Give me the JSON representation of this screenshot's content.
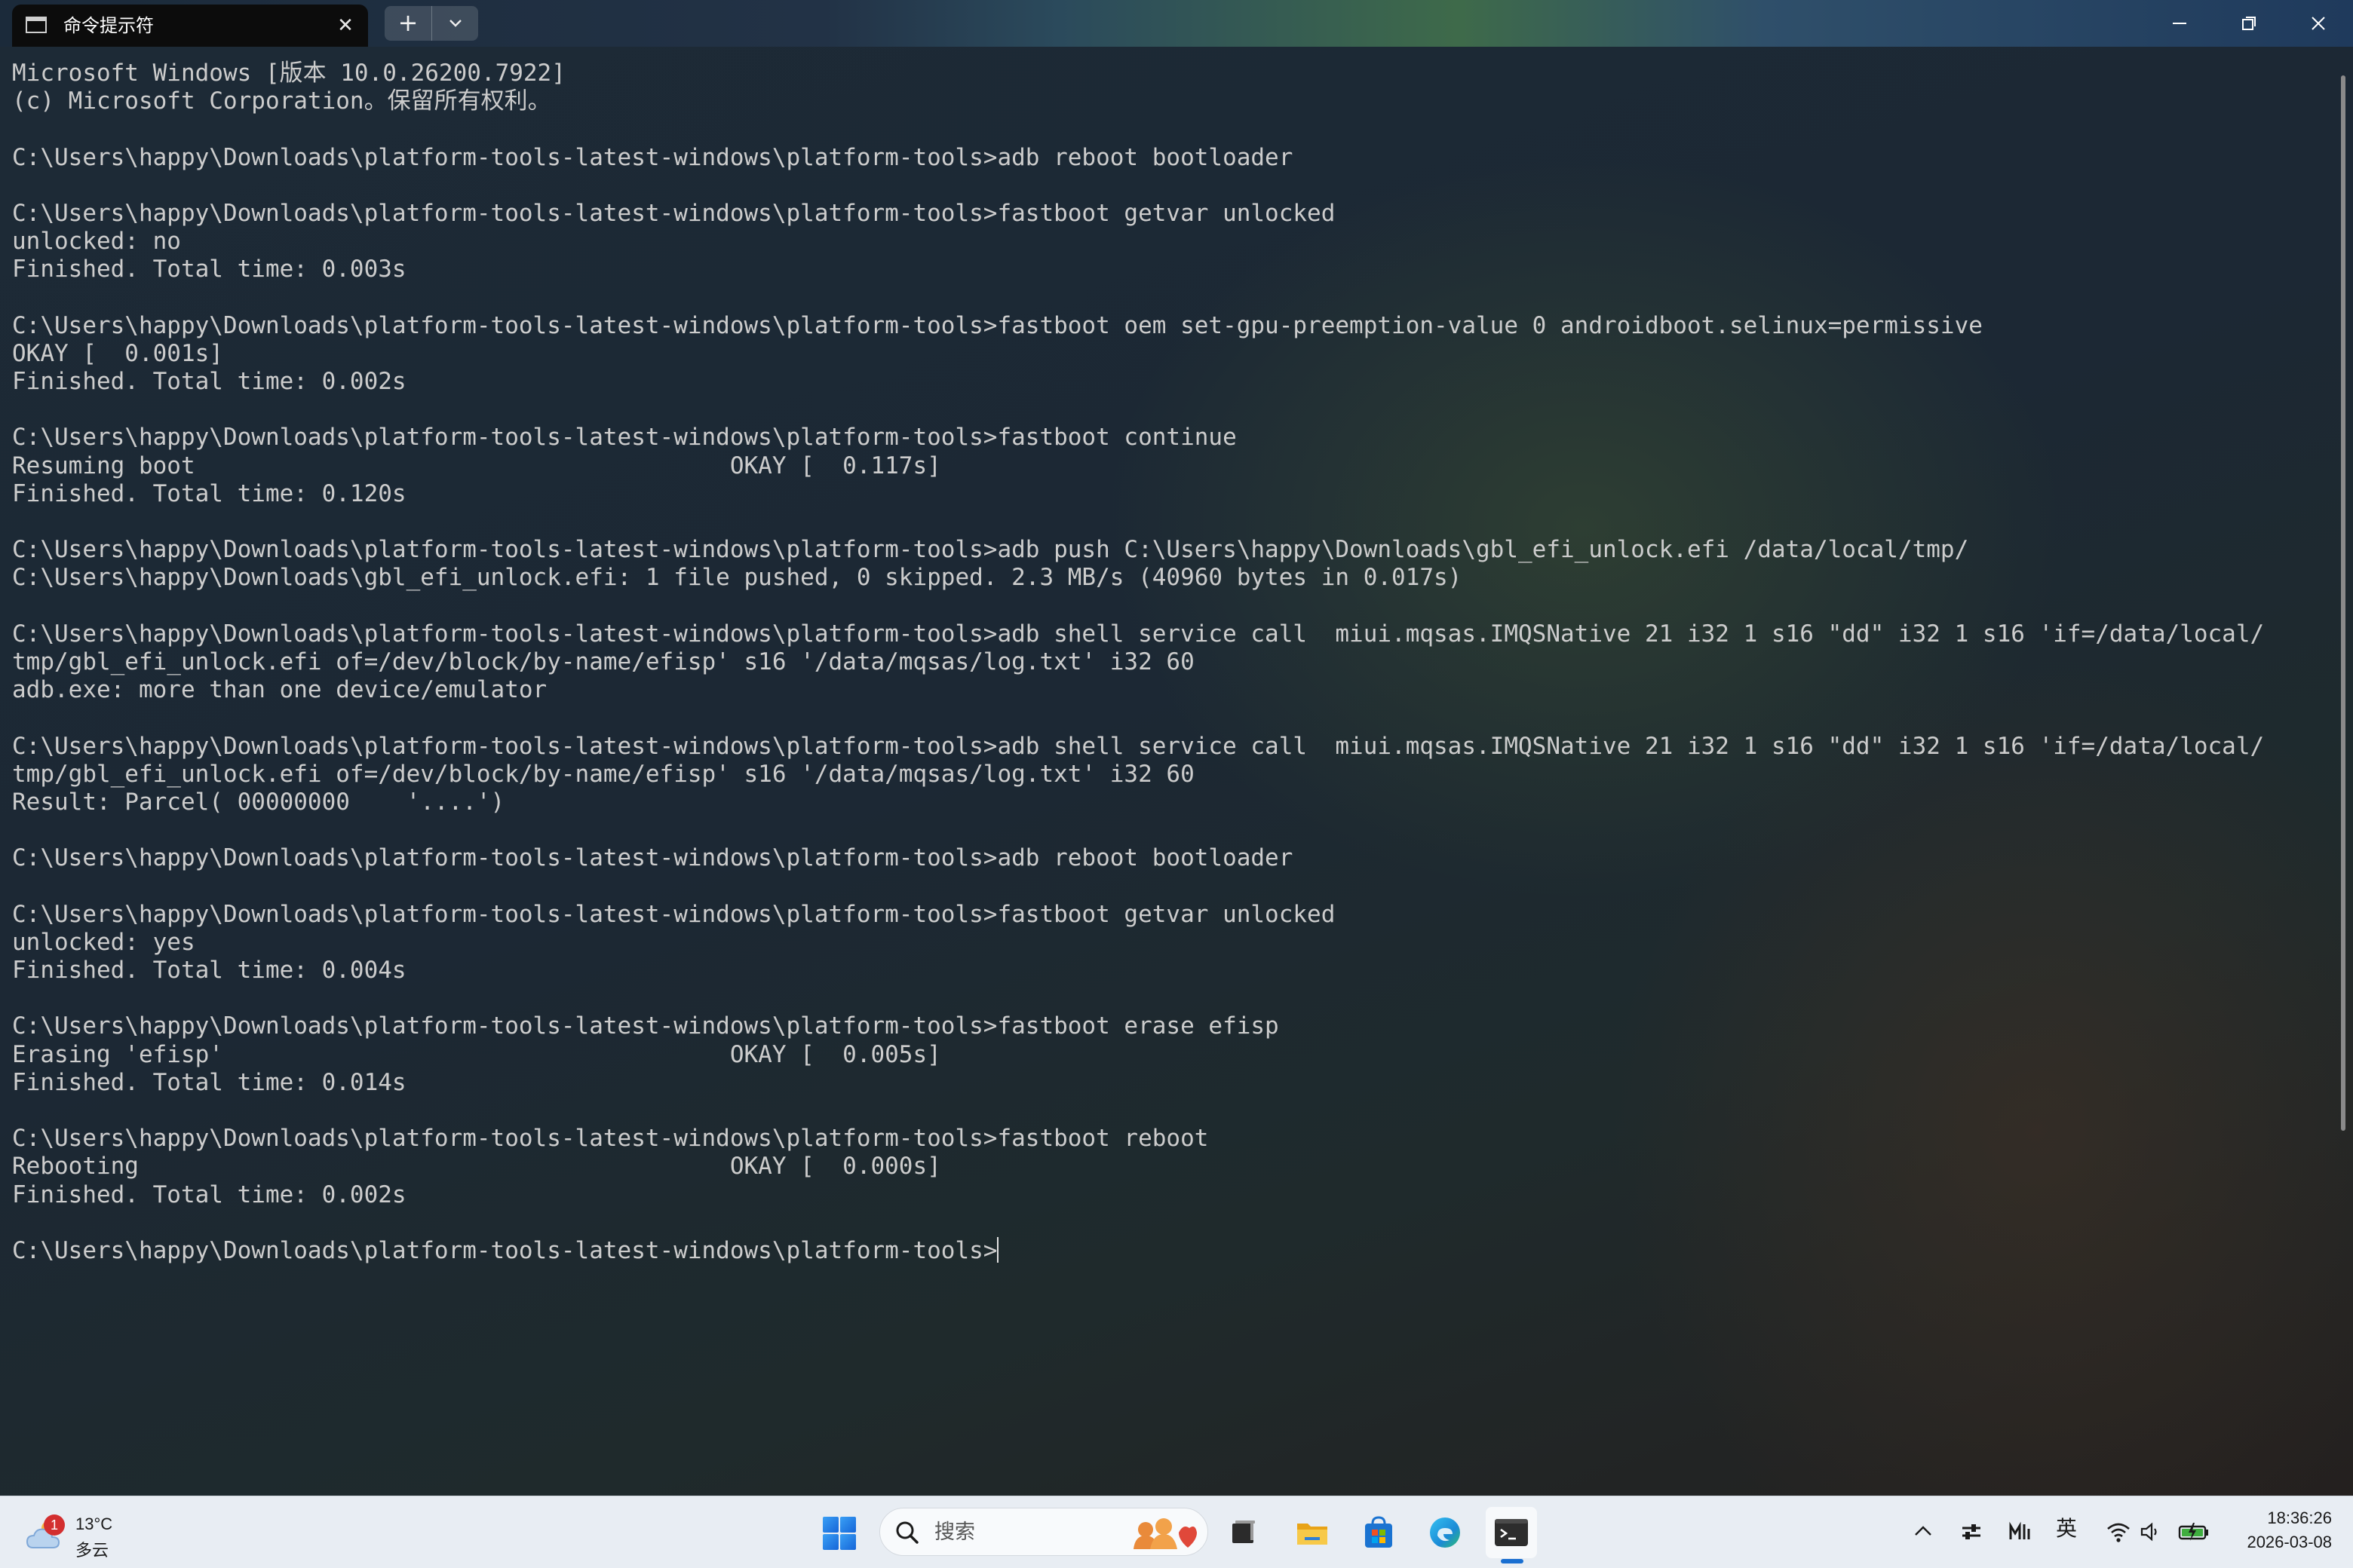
{
  "window": {
    "tab_title": "命令提示符",
    "tab_close_glyph": "✕",
    "new_tab_glyph": "+"
  },
  "terminal": {
    "lines": [
      "Microsoft Windows [版本 10.0.26200.7922]",
      "(c) Microsoft Corporation。保留所有权利。",
      "",
      "C:\\Users\\happy\\Downloads\\platform-tools-latest-windows\\platform-tools>adb reboot bootloader",
      "",
      "C:\\Users\\happy\\Downloads\\platform-tools-latest-windows\\platform-tools>fastboot getvar unlocked",
      "unlocked: no",
      "Finished. Total time: 0.003s",
      "",
      "C:\\Users\\happy\\Downloads\\platform-tools-latest-windows\\platform-tools>fastboot oem set-gpu-preemption-value 0 androidboot.selinux=permissive",
      "OKAY [  0.001s]",
      "Finished. Total time: 0.002s",
      "",
      "C:\\Users\\happy\\Downloads\\platform-tools-latest-windows\\platform-tools>fastboot continue",
      "Resuming boot                                      OKAY [  0.117s]",
      "Finished. Total time: 0.120s",
      "",
      "C:\\Users\\happy\\Downloads\\platform-tools-latest-windows\\platform-tools>adb push C:\\Users\\happy\\Downloads\\gbl_efi_unlock.efi /data/local/tmp/",
      "C:\\Users\\happy\\Downloads\\gbl_efi_unlock.efi: 1 file pushed, 0 skipped. 2.3 MB/s (40960 bytes in 0.017s)",
      "",
      "C:\\Users\\happy\\Downloads\\platform-tools-latest-windows\\platform-tools>adb shell service call  miui.mqsas.IMQSNative 21 i32 1 s16 \"dd\" i32 1 s16 'if=/data/local/",
      "tmp/gbl_efi_unlock.efi of=/dev/block/by-name/efisp' s16 '/data/mqsas/log.txt' i32 60",
      "adb.exe: more than one device/emulator",
      "",
      "C:\\Users\\happy\\Downloads\\platform-tools-latest-windows\\platform-tools>adb shell service call  miui.mqsas.IMQSNative 21 i32 1 s16 \"dd\" i32 1 s16 'if=/data/local/",
      "tmp/gbl_efi_unlock.efi of=/dev/block/by-name/efisp' s16 '/data/mqsas/log.txt' i32 60",
      "Result: Parcel( 00000000    '....')",
      "",
      "C:\\Users\\happy\\Downloads\\platform-tools-latest-windows\\platform-tools>adb reboot bootloader",
      "",
      "C:\\Users\\happy\\Downloads\\platform-tools-latest-windows\\platform-tools>fastboot getvar unlocked",
      "unlocked: yes",
      "Finished. Total time: 0.004s",
      "",
      "C:\\Users\\happy\\Downloads\\platform-tools-latest-windows\\platform-tools>fastboot erase efisp",
      "Erasing 'efisp'                                    OKAY [  0.005s]",
      "Finished. Total time: 0.014s",
      "",
      "C:\\Users\\happy\\Downloads\\platform-tools-latest-windows\\platform-tools>fastboot reboot",
      "Rebooting                                          OKAY [  0.000s]",
      "Finished. Total time: 0.002s",
      ""
    ],
    "prompt": "C:\\Users\\happy\\Downloads\\platform-tools-latest-windows\\platform-tools>"
  },
  "taskbar": {
    "weather": {
      "badge_count": "1",
      "temperature": "13°C",
      "condition": "多云",
      "icon": "cloud-icon"
    },
    "search_placeholder": "搜索",
    "apps": [
      "start-icon",
      "taskview-icon",
      "file-explorer-icon",
      "store-icon",
      "edge-icon",
      "terminal-icon"
    ],
    "tray": {
      "ime_label": "英",
      "icons": [
        "chevron-up-icon",
        "switch-icon",
        "ime-mode-icon",
        "wifi-icon",
        "volume-icon",
        "battery-charging-icon"
      ]
    },
    "clock": {
      "time": "18:36:26",
      "date": "2026-03-08"
    }
  },
  "colors": {
    "terminal_text": "#cccccc",
    "taskbar_bg": "#e8edf3",
    "accent": "#1a6fd1",
    "badge": "#d32f2f"
  }
}
